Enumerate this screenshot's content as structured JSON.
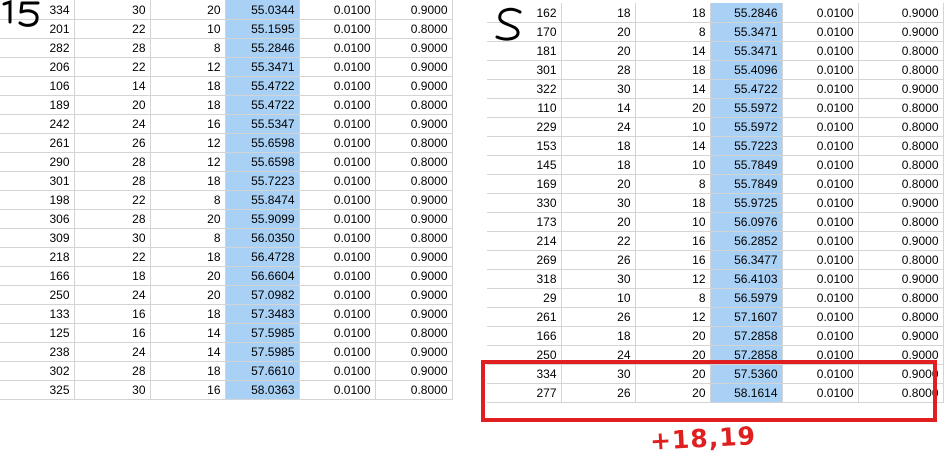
{
  "colors": {
    "highlight_column": "#a9d0f5",
    "annotation_red": "#e02020",
    "grid": "#d4d4d4"
  },
  "left_panel": {
    "marker": "15",
    "rows": [
      [
        "334",
        "30",
        "20",
        "55.0344",
        "0.0100",
        "0.9000"
      ],
      [
        "201",
        "22",
        "10",
        "55.1595",
        "0.0100",
        "0.8000"
      ],
      [
        "282",
        "28",
        "8",
        "55.2846",
        "0.0100",
        "0.9000"
      ],
      [
        "206",
        "22",
        "12",
        "55.3471",
        "0.0100",
        "0.9000"
      ],
      [
        "106",
        "14",
        "18",
        "55.4722",
        "0.0100",
        "0.9000"
      ],
      [
        "189",
        "20",
        "18",
        "55.4722",
        "0.0100",
        "0.8000"
      ],
      [
        "242",
        "24",
        "16",
        "55.5347",
        "0.0100",
        "0.9000"
      ],
      [
        "261",
        "26",
        "12",
        "55.6598",
        "0.0100",
        "0.8000"
      ],
      [
        "290",
        "28",
        "12",
        "55.6598",
        "0.0100",
        "0.8000"
      ],
      [
        "301",
        "28",
        "18",
        "55.7223",
        "0.0100",
        "0.8000"
      ],
      [
        "198",
        "22",
        "8",
        "55.8474",
        "0.0100",
        "0.9000"
      ],
      [
        "306",
        "28",
        "20",
        "55.9099",
        "0.0100",
        "0.9000"
      ],
      [
        "309",
        "30",
        "8",
        "56.0350",
        "0.0100",
        "0.8000"
      ],
      [
        "218",
        "22",
        "18",
        "56.4728",
        "0.0100",
        "0.9000"
      ],
      [
        "166",
        "18",
        "20",
        "56.6604",
        "0.0100",
        "0.9000"
      ],
      [
        "250",
        "24",
        "20",
        "57.0982",
        "0.0100",
        "0.9000"
      ],
      [
        "133",
        "16",
        "18",
        "57.3483",
        "0.0100",
        "0.9000"
      ],
      [
        "125",
        "16",
        "14",
        "57.5985",
        "0.0100",
        "0.8000"
      ],
      [
        "238",
        "24",
        "14",
        "57.5985",
        "0.0100",
        "0.9000"
      ],
      [
        "302",
        "28",
        "18",
        "57.6610",
        "0.0100",
        "0.9000"
      ],
      [
        "325",
        "30",
        "16",
        "58.0363",
        "0.0100",
        "0.8000"
      ]
    ]
  },
  "right_panel": {
    "marker": "5",
    "rows": [
      [
        "162",
        "18",
        "18",
        "55.2846",
        "0.0100",
        "0.9000"
      ],
      [
        "170",
        "20",
        "8",
        "55.3471",
        "0.0100",
        "0.9000"
      ],
      [
        "181",
        "20",
        "14",
        "55.3471",
        "0.0100",
        "0.8000"
      ],
      [
        "301",
        "28",
        "18",
        "55.4096",
        "0.0100",
        "0.8000"
      ],
      [
        "322",
        "30",
        "14",
        "55.4722",
        "0.0100",
        "0.9000"
      ],
      [
        "110",
        "14",
        "20",
        "55.5972",
        "0.0100",
        "0.8000"
      ],
      [
        "229",
        "24",
        "10",
        "55.5972",
        "0.0100",
        "0.8000"
      ],
      [
        "153",
        "18",
        "14",
        "55.7223",
        "0.0100",
        "0.8000"
      ],
      [
        "145",
        "18",
        "10",
        "55.7849",
        "0.0100",
        "0.8000"
      ],
      [
        "169",
        "20",
        "8",
        "55.7849",
        "0.0100",
        "0.8000"
      ],
      [
        "330",
        "30",
        "18",
        "55.9725",
        "0.0100",
        "0.9000"
      ],
      [
        "173",
        "20",
        "10",
        "56.0976",
        "0.0100",
        "0.8000"
      ],
      [
        "214",
        "22",
        "16",
        "56.2852",
        "0.0100",
        "0.9000"
      ],
      [
        "269",
        "26",
        "16",
        "56.3477",
        "0.0100",
        "0.8000"
      ],
      [
        "318",
        "30",
        "12",
        "56.4103",
        "0.0100",
        "0.9000"
      ],
      [
        "29",
        "10",
        "8",
        "56.5979",
        "0.0100",
        "0.8000"
      ],
      [
        "261",
        "26",
        "12",
        "57.1607",
        "0.0100",
        "0.8000"
      ],
      [
        "166",
        "18",
        "20",
        "57.2858",
        "0.0100",
        "0.9000"
      ],
      [
        "250",
        "24",
        "20",
        "57.2858",
        "0.0100",
        "0.9000"
      ],
      [
        "334",
        "30",
        "20",
        "57.5360",
        "0.0100",
        "0.9000"
      ],
      [
        "277",
        "26",
        "20",
        "58.1614",
        "0.0100",
        "0.8000"
      ]
    ]
  },
  "annotation": {
    "note": "+18,19"
  }
}
